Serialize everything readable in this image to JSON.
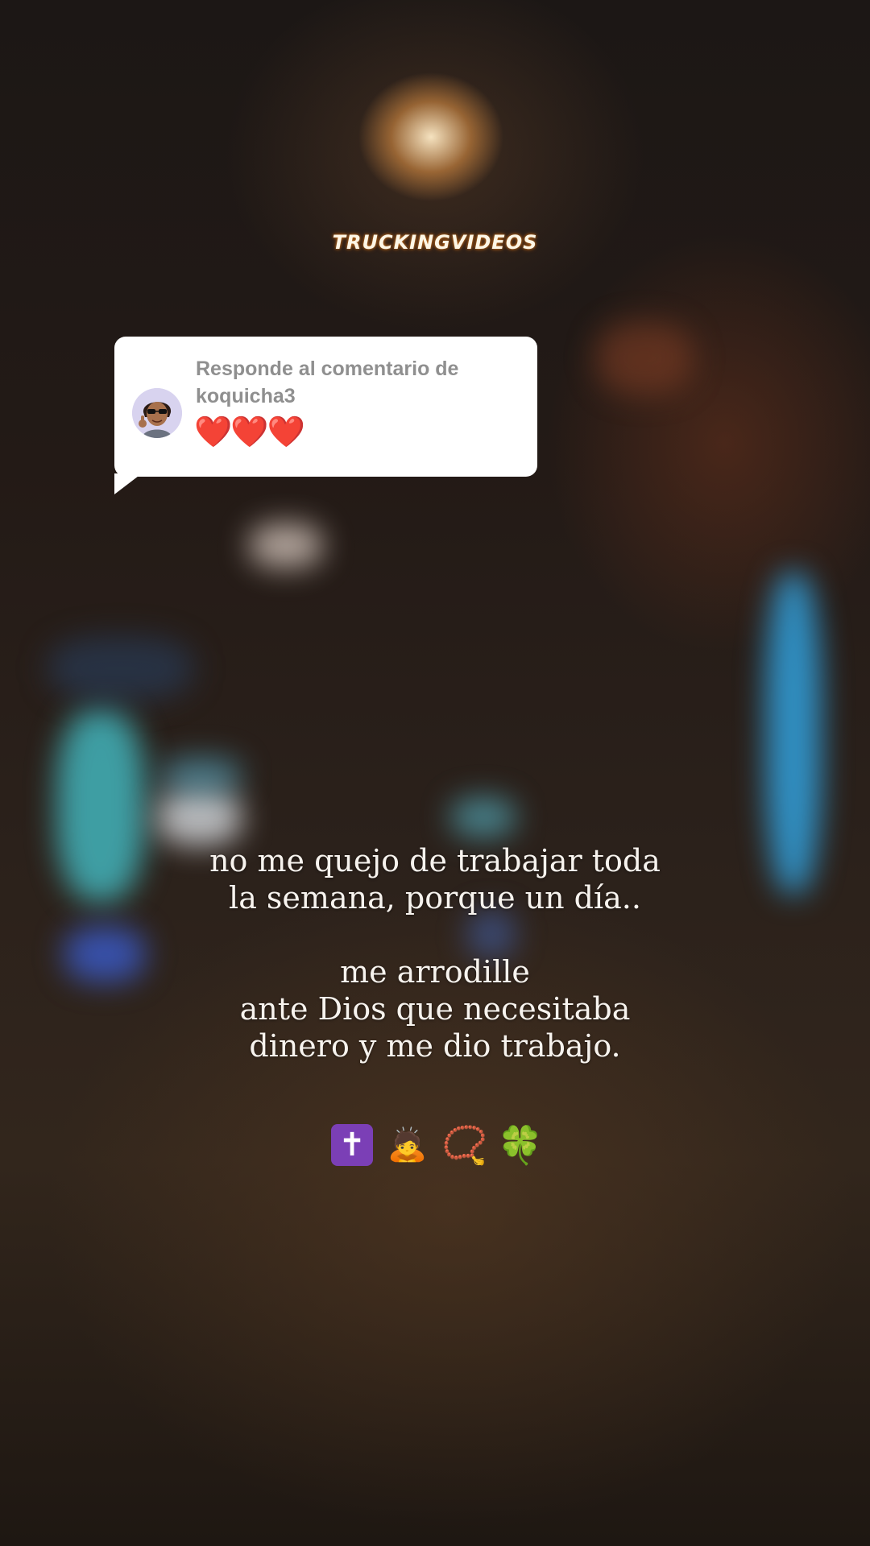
{
  "watermark": {
    "text": "TRUCKINGVIDEOS"
  },
  "reply_card": {
    "label": "Responde al comentario de",
    "username": "koquicha3",
    "comment": "❤️❤️❤️",
    "avatar_icon": "avatar-icon"
  },
  "caption": {
    "line1": "no me quejo de trabajar toda",
    "line2": "la semana, porque un día..",
    "line3": "me arrodille",
    "line4": "ante Dios que necesitaba",
    "line5": "dinero y me dio trabajo."
  },
  "emojis": {
    "cross": "✝",
    "person": "🙇",
    "rosary": "📿",
    "clover": "🍀"
  },
  "colors": {
    "card_background": "#ffffff",
    "card_text": "#8f8f8f",
    "heart": "#e0141e",
    "caption_text": "#f7f3ee",
    "watermark_glow": "#c8741e"
  }
}
